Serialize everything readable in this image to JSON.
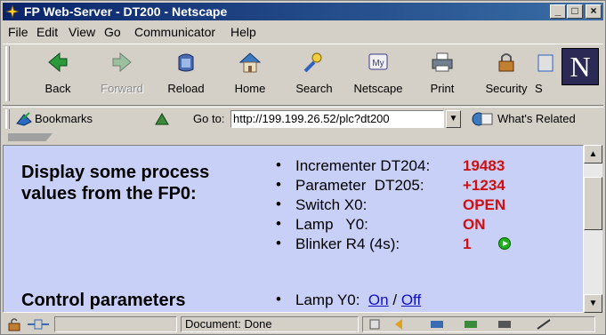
{
  "window": {
    "title": "FP Web-Server - DT200 - Netscape"
  },
  "menu": [
    "File",
    "Edit",
    "View",
    "Go",
    "Communicator",
    "Help"
  ],
  "toolbar": {
    "buttons": [
      {
        "label": "Back",
        "icon": "back-arrow-icon"
      },
      {
        "label": "Forward",
        "icon": "forward-arrow-icon"
      },
      {
        "label": "Reload",
        "icon": "reload-icon"
      },
      {
        "label": "Home",
        "icon": "home-icon"
      },
      {
        "label": "Search",
        "icon": "search-icon"
      },
      {
        "label": "Netscape",
        "icon": "netscape-mailbox-icon"
      },
      {
        "label": "Print",
        "icon": "printer-icon"
      },
      {
        "label": "Security",
        "icon": "lock-icon"
      },
      {
        "label": "S",
        "icon": "shop-icon"
      }
    ]
  },
  "location": {
    "bookmarks_label": "Bookmarks",
    "goto_label": "Go to:",
    "url": "http://199.199.26.52/plc?dt200",
    "related_label": "What's Related"
  },
  "content": {
    "heading1": "Display some process values from the FP0:",
    "heading2": "Control parameters",
    "values": [
      {
        "label": "Incrementer DT204:",
        "value": "19483"
      },
      {
        "label": "Parameter  DT205:",
        "value": "+1234"
      },
      {
        "label": "Switch X0:",
        "value": "OPEN"
      },
      {
        "label": "Lamp   Y0:",
        "value": "ON"
      },
      {
        "label": "Blinker R4 (4s):",
        "value": "1"
      }
    ],
    "lamp_control": {
      "label": "Lamp Y0:",
      "on": "On",
      "sep": "/",
      "off": "Off"
    }
  },
  "status": {
    "text": "Document: Done"
  },
  "colors": {
    "content_bg": "#c8d0f8",
    "value_red": "#d01010",
    "link_blue": "#1010c0",
    "title_bar": "#0a246a"
  }
}
